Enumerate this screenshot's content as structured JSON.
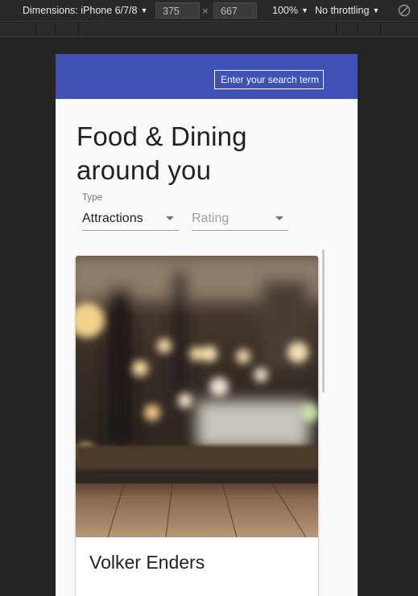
{
  "devtools": {
    "dimensions_label": "Dimensions: iPhone 6/7/8",
    "width_value": "375",
    "height_value": "667",
    "times_symbol": "×",
    "zoom_label": "100%",
    "throttle_label": "No throttling"
  },
  "app": {
    "search_placeholder": "Enter your search term",
    "page_title": "Food & Dining around you",
    "filters": {
      "type_label": "Type",
      "type_value": "Attractions",
      "rating_placeholder": "Rating"
    },
    "card": {
      "title": "Volker Enders",
      "image_description": "blurred restaurant interior with wooden table"
    }
  },
  "colors": {
    "appbar": "#3f51b5",
    "page_background": "#fafafa",
    "devtools_background": "#242424",
    "title_text": "#212121"
  },
  "icons": {
    "dropdown": "triangle-down",
    "rotate": "rotate-disabled-icon"
  }
}
